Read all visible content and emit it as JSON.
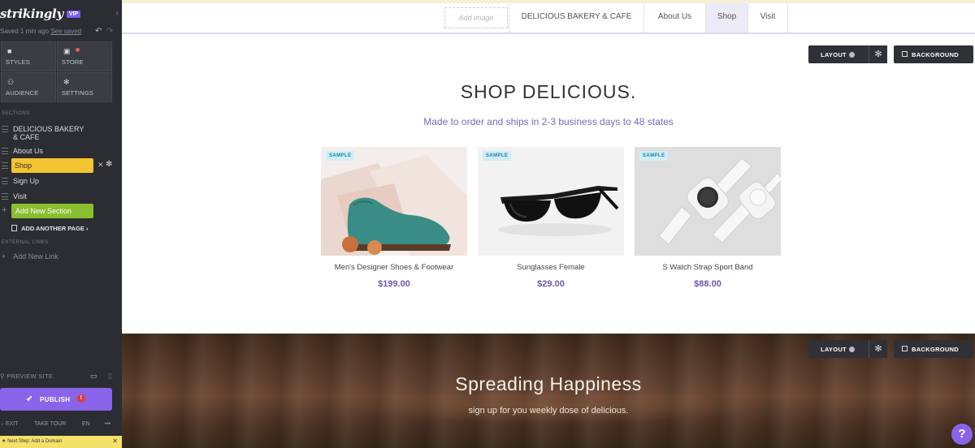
{
  "sidebar": {
    "brand": "strikingly",
    "vip_badge": "VIP",
    "saved_text": "Saved 1 min ago",
    "saved_link": "See saved",
    "tiles": [
      {
        "label": "STYLES",
        "icon": "palette-icon"
      },
      {
        "label": "STORE",
        "icon": "lock-icon"
      },
      {
        "label": "AUDIENCE",
        "icon": "users-icon"
      },
      {
        "label": "SETTINGS",
        "icon": "gear-icon"
      }
    ],
    "sections_title": "SECTIONS",
    "sections": [
      {
        "label": "DELICIOUS BAKERY & CAFE"
      },
      {
        "label": "About Us"
      },
      {
        "label": "Shop",
        "active": true
      },
      {
        "label": "Sign Up"
      },
      {
        "label": "Visit"
      }
    ],
    "add_section": "Add New Section",
    "add_page": "ADD ANOTHER PAGE",
    "external_title": "EXTERNAL LINKS",
    "add_link": "Add New Link",
    "preview": "PREVIEW SITE",
    "publish": "PUBLISH",
    "publish_badge": "!",
    "bottom": {
      "exit": "EXIT",
      "tour": "TAKE TOUR",
      "lang": "EN",
      "more": "•••"
    },
    "footer": "Next Step: Add a Domain",
    "colors": {
      "bg": "#2b2d33",
      "active": "#f5c431",
      "add": "#8abf2f",
      "publish": "#8a64e8"
    }
  },
  "nav": {
    "logo_placeholder": "Add image",
    "items": [
      "DELICIOUS BAKERY & CAFE",
      "About Us",
      "Shop",
      "Visit"
    ],
    "active": "Shop"
  },
  "shop": {
    "controls": {
      "layout": "LAYOUT",
      "background": "BACKGROUND"
    },
    "title": "SHOP DELICIOUS.",
    "subtitle": "Made to order and ships in 2-3 business days to 48 states",
    "sample_badge": "SAMPLE",
    "products": [
      {
        "name": "Men's Designer Shoes & Footwear",
        "price": "$199.00",
        "image": "shoe"
      },
      {
        "name": "Sunglasses Female",
        "price": "$29.00",
        "image": "sunglasses"
      },
      {
        "name": "S Watch Strap Sport Band",
        "price": "$88.00",
        "image": "watch"
      }
    ]
  },
  "happiness": {
    "controls": {
      "layout": "LAYOUT",
      "background": "BACKGROUND"
    },
    "title": "Spreading Happiness",
    "subtitle": "sign up for you weekly dose of delicious."
  },
  "help_button": "?"
}
